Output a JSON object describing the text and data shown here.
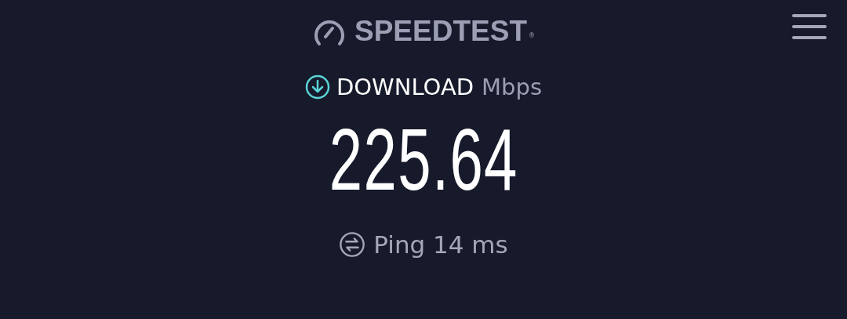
{
  "header": {
    "logo_text": "SPEEDTEST",
    "trademark": "®"
  },
  "download": {
    "label": "DOWNLOAD",
    "unit": "Mbps",
    "value": "225.64"
  },
  "ping": {
    "label": "Ping 14 ms"
  }
}
